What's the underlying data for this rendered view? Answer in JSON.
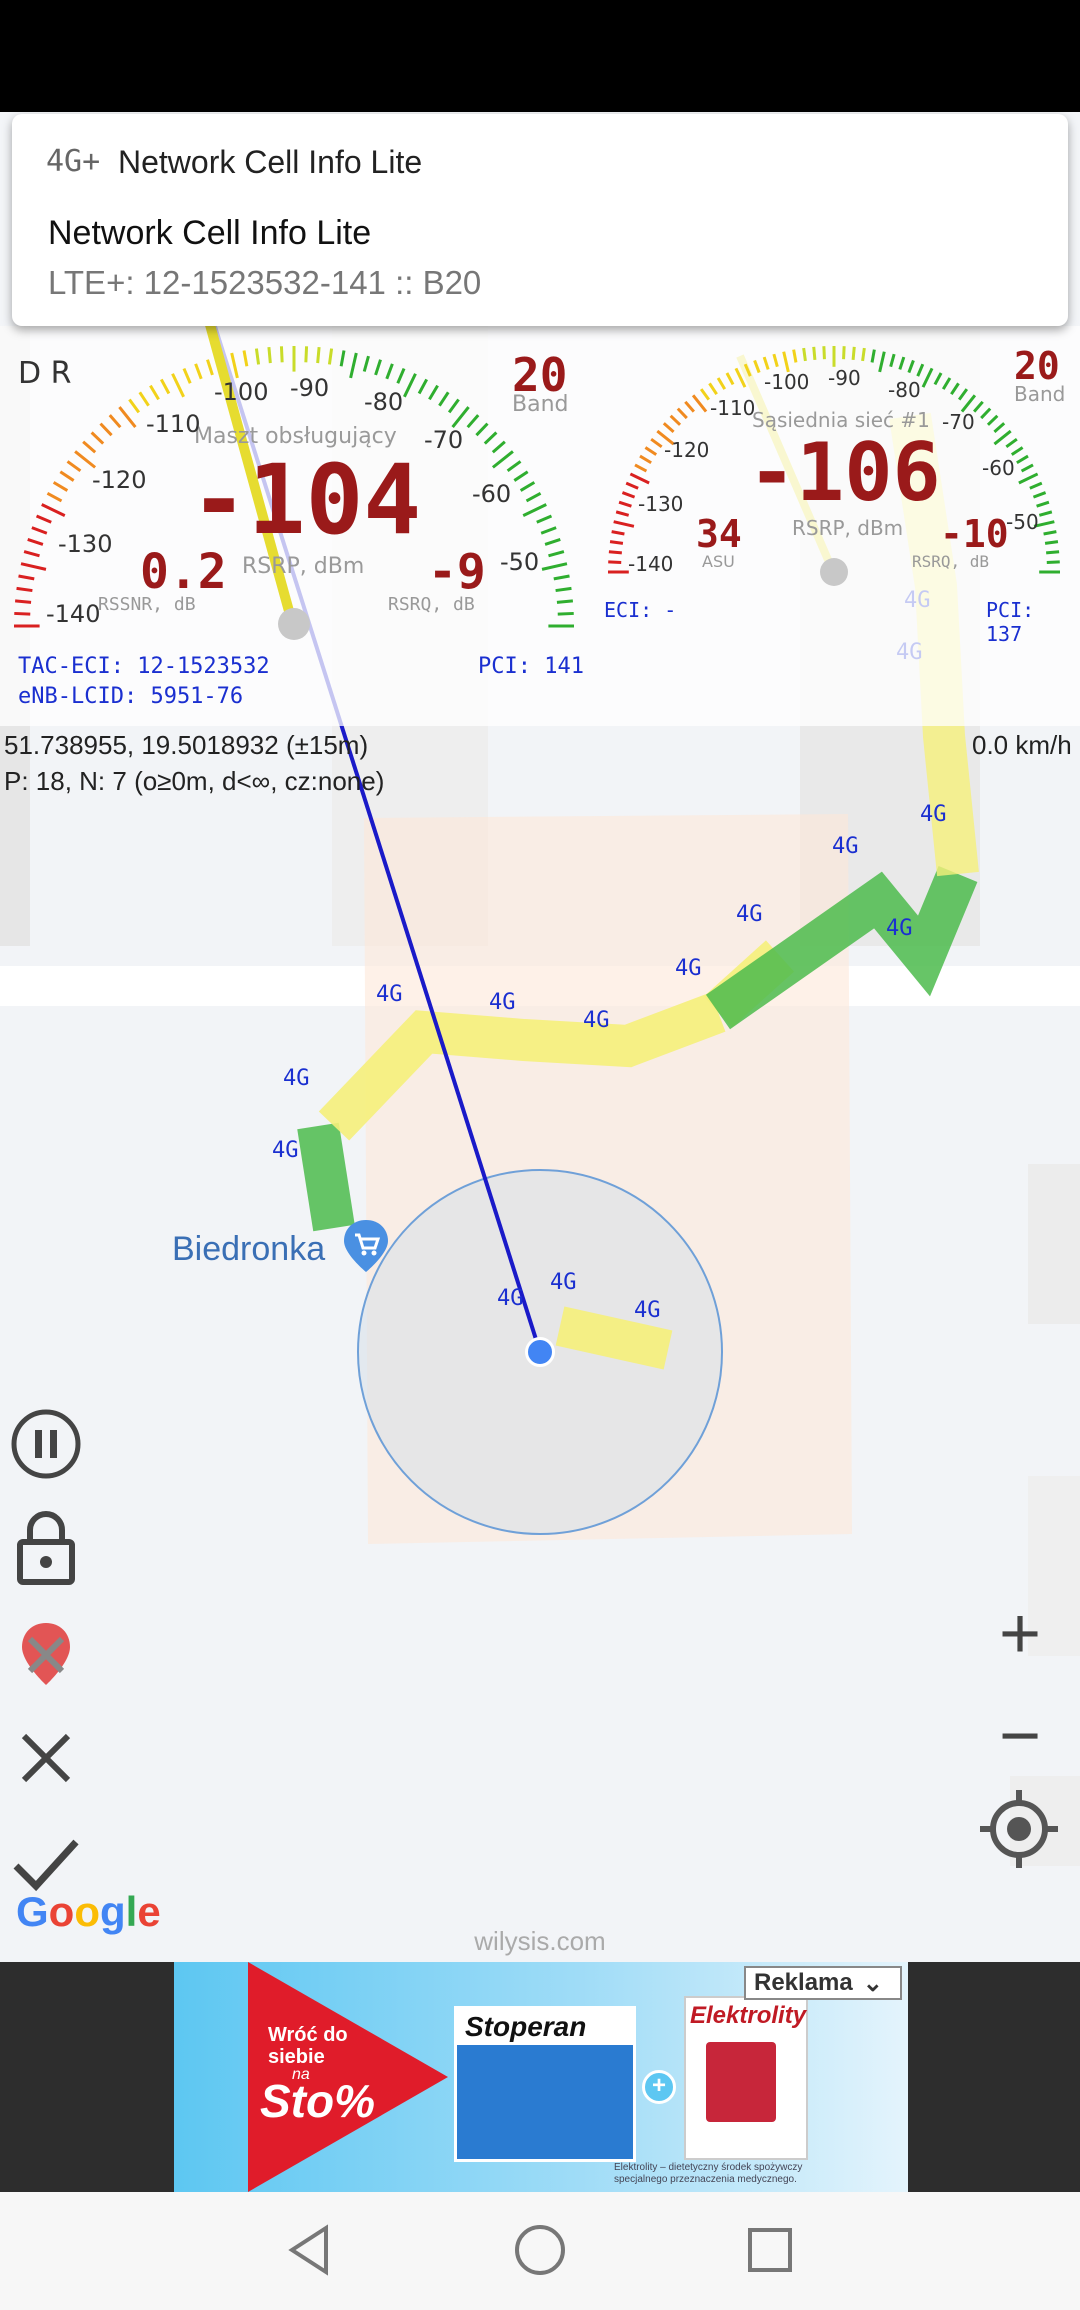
{
  "notification": {
    "app_icon": "4G+",
    "app_name": "Network Cell Info Lite",
    "title": "Network Cell Info Lite",
    "text": "LTE+: 12-1523532-141 :: B20"
  },
  "gauge_left": {
    "mode": "D R",
    "label": "Maszt obsługujący",
    "value": "-104",
    "unit": "RSRP, dBm",
    "band_value": "20",
    "band_label": "Band",
    "rssnr_value": "0.2",
    "rssnr_label": "RSSNR, dB",
    "rsrq_value": "-9",
    "rsrq_label": "RSRQ, dB",
    "ticks": [
      "-140",
      "-130",
      "-120",
      "-110",
      "-100",
      "-90",
      "-80",
      "-70",
      "-60",
      "-50"
    ],
    "tac_eci": "TAC-ECI: 12-1523532",
    "enb_lcid": "eNB-LCID: 5951-76",
    "pci": "PCI: 141"
  },
  "gauge_right": {
    "label": "Sąsiednia sieć #1",
    "value": "-106",
    "unit": "RSRP, dBm",
    "band_value": "20",
    "band_label": "Band",
    "asu_value": "34",
    "asu_label": "ASU",
    "rsrq_value": "-10",
    "rsrq_label": "RSRQ, dB",
    "ticks": [
      "-140",
      "-130",
      "-120",
      "-110",
      "-100",
      "-90",
      "-80",
      "-70",
      "-60",
      "-50"
    ],
    "eci": "ECI: -",
    "pci": "PCI: 137"
  },
  "location": {
    "coords": "51.738955, 19.5018932 (±15m)",
    "stats": "P: 18, N: 7 (o≥0m, d<∞, cz:none)",
    "speed": "0.0 km/h"
  },
  "map": {
    "poi_label": "Biedronka",
    "marker_label": "4G",
    "google": "Google",
    "watermark": "wilysis.com"
  },
  "controls": {
    "zoom_in": "+",
    "zoom_out": "−"
  },
  "ad": {
    "badge": "Reklama",
    "headline": "Wróć do siebie",
    "headline_na": "na",
    "headline_big": "Sto%",
    "brand1": "Stoperan",
    "brand2": "Elektrolity",
    "fine_print": "Elektrolity – dietetyczny środek spożywczy specjalnego przeznaczenia medycznego."
  },
  "colors": {
    "track_green": "#4cbb4c",
    "track_yellow": "#f5f07a",
    "line_blue": "#1a1ac8",
    "location_blue": "#4285f4",
    "gauge_value": "#9a1a1a"
  }
}
